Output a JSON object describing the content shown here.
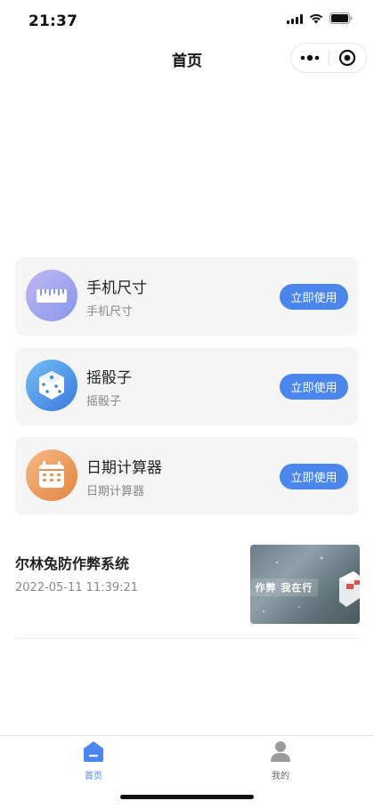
{
  "status_bar": {
    "time": "21:37"
  },
  "nav": {
    "title": "首页"
  },
  "tools": [
    {
      "title": "手机尺寸",
      "subtitle": "手机尺寸",
      "button": "立即使用",
      "icon": "ruler-icon",
      "colors": [
        "#B7B7F0",
        "#8A96EE"
      ]
    },
    {
      "title": "摇骰子",
      "subtitle": "摇骰子",
      "button": "立即使用",
      "icon": "dice-icon",
      "colors": [
        "#6EB6F2",
        "#3E7EE0"
      ]
    },
    {
      "title": "日期计算器",
      "subtitle": "日期计算器",
      "button": "立即使用",
      "icon": "calendar-icon",
      "colors": [
        "#F2B27A",
        "#E3894A"
      ]
    }
  ],
  "article": {
    "title": "尔林兔防作弊系统",
    "date": "2022-05-11 11:39:21",
    "thumb_text": "作弊  我在行"
  },
  "tab_bar": {
    "items": [
      {
        "label": "首页",
        "icon": "home-icon",
        "active": true
      },
      {
        "label": "我的",
        "icon": "user-icon",
        "active": false
      }
    ]
  },
  "colors": {
    "accent": "#4A86EB",
    "card_bg": "#F5F5F5",
    "muted_text": "#888888"
  }
}
